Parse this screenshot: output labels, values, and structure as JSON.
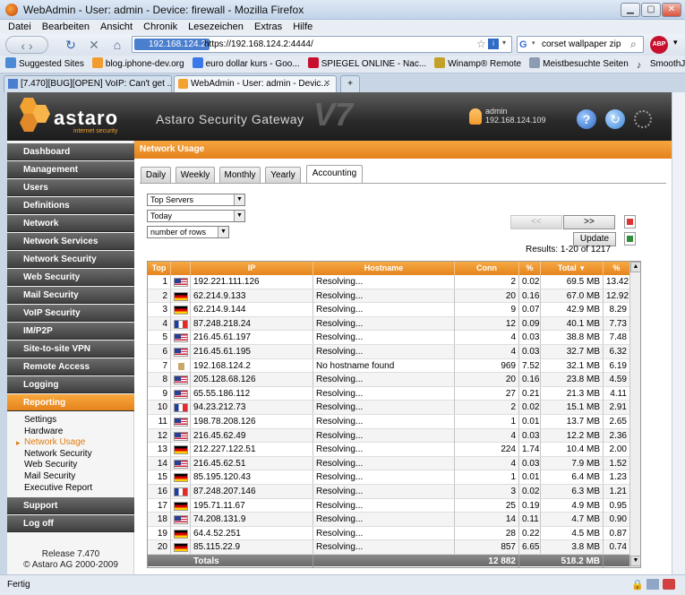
{
  "window": {
    "title": "WebAdmin - User: admin - Device: firewall - Mozilla Firefox"
  },
  "menu": [
    "Datei",
    "Bearbeiten",
    "Ansicht",
    "Chronik",
    "Lesezeichen",
    "Extras",
    "Hilfe"
  ],
  "address": {
    "site": "192.168.124.2",
    "url": "https://192.168.124.2:4444/"
  },
  "search": {
    "value": "corset wallpaper zip"
  },
  "bookmarks": [
    "Suggested Sites",
    "blog.iphone-dev.org",
    "euro dollar kurs - Goo...",
    "SPIEGEL ONLINE - Nac...",
    "Winamp® Remote",
    "Meistbesuchte Seiten",
    "SmoothJazz.com : The..."
  ],
  "browser_tabs": [
    {
      "label": "[7.470][BUG][OPEN] VoIP: Can't get ...",
      "active": false
    },
    {
      "label": "WebAdmin - User: admin - Devic...",
      "active": true
    }
  ],
  "header": {
    "brand": "astaro",
    "brand_sub": "internet security",
    "product": "Astaro Security Gateway",
    "version_mark": "V7",
    "user_label": "admin",
    "user_ip": "192.168.124.109"
  },
  "nav": {
    "items": [
      "Dashboard",
      "Management",
      "Users",
      "Definitions",
      "Network",
      "Network Services",
      "Network Security",
      "Web Security",
      "Mail Security",
      "VoIP Security",
      "IM/P2P",
      "Site-to-site VPN",
      "Remote Access",
      "Logging",
      "Reporting"
    ],
    "active": "Reporting",
    "sub_items": [
      "Settings",
      "Hardware",
      "Network Usage",
      "Network Security",
      "Web Security",
      "Mail Security",
      "Executive Report"
    ],
    "active_sub": "Network Usage",
    "bottom_items": [
      "Support",
      "Log off"
    ],
    "release": "Release 7.470",
    "copyright": "© Astaro AG 2000-2009"
  },
  "content": {
    "title": "Network Usage",
    "tabs": [
      "Daily",
      "Weekly",
      "Monthly",
      "Yearly",
      "Accounting"
    ],
    "active_tab": "Accounting",
    "filter_select": "Top Servers",
    "period_select": "Today",
    "rows_select": "number of rows",
    "prev_label": "<<",
    "next_label": ">>",
    "update_label": "Update",
    "results": "Results: 1-20 of 1217",
    "sort_arrow": "▼"
  },
  "table": {
    "headers": [
      "Top",
      "IP",
      "Hostname",
      "Conn",
      "%",
      "Total",
      "%"
    ],
    "rows": [
      {
        "top": "1",
        "flag": "us",
        "ip": "192.221.111.126",
        "host": "Resolving...",
        "conn": "2",
        "cpct": "0.02",
        "total": "69.5 MB",
        "tpct": "13.42"
      },
      {
        "top": "2",
        "flag": "de",
        "ip": "62.214.9.133",
        "host": "Resolving...",
        "conn": "20",
        "cpct": "0.16",
        "total": "67.0 MB",
        "tpct": "12.92"
      },
      {
        "top": "3",
        "flag": "de",
        "ip": "62.214.9.144",
        "host": "Resolving...",
        "conn": "9",
        "cpct": "0.07",
        "total": "42.9 MB",
        "tpct": "8.29"
      },
      {
        "top": "4",
        "flag": "fr",
        "ip": "87.248.218.24",
        "host": "Resolving...",
        "conn": "12",
        "cpct": "0.09",
        "total": "40.1 MB",
        "tpct": "7.73"
      },
      {
        "top": "5",
        "flag": "us",
        "ip": "216.45.61.197",
        "host": "Resolving...",
        "conn": "4",
        "cpct": "0.03",
        "total": "38.8 MB",
        "tpct": "7.48"
      },
      {
        "top": "6",
        "flag": "us",
        "ip": "216.45.61.195",
        "host": "Resolving...",
        "conn": "4",
        "cpct": "0.03",
        "total": "32.7 MB",
        "tpct": "6.32"
      },
      {
        "top": "7",
        "flag": "lan",
        "ip": "192.168.124.2",
        "host": "No hostname found",
        "conn": "969",
        "cpct": "7.52",
        "total": "32.1 MB",
        "tpct": "6.19"
      },
      {
        "top": "8",
        "flag": "us",
        "ip": "205.128.68.126",
        "host": "Resolving...",
        "conn": "20",
        "cpct": "0.16",
        "total": "23.8 MB",
        "tpct": "4.59"
      },
      {
        "top": "9",
        "flag": "us",
        "ip": "65.55.186.112",
        "host": "Resolving...",
        "conn": "27",
        "cpct": "0.21",
        "total": "21.3 MB",
        "tpct": "4.11"
      },
      {
        "top": "10",
        "flag": "fr",
        "ip": "94.23.212.73",
        "host": "Resolving...",
        "conn": "2",
        "cpct": "0.02",
        "total": "15.1 MB",
        "tpct": "2.91"
      },
      {
        "top": "11",
        "flag": "us",
        "ip": "198.78.208.126",
        "host": "Resolving...",
        "conn": "1",
        "cpct": "0.01",
        "total": "13.7 MB",
        "tpct": "2.65"
      },
      {
        "top": "12",
        "flag": "us",
        "ip": "216.45.62.49",
        "host": "Resolving...",
        "conn": "4",
        "cpct": "0.03",
        "total": "12.2 MB",
        "tpct": "2.36"
      },
      {
        "top": "13",
        "flag": "de",
        "ip": "212.227.122.51",
        "host": "Resolving...",
        "conn": "224",
        "cpct": "1.74",
        "total": "10.4 MB",
        "tpct": "2.00"
      },
      {
        "top": "14",
        "flag": "us",
        "ip": "216.45.62.51",
        "host": "Resolving...",
        "conn": "4",
        "cpct": "0.03",
        "total": "7.9 MB",
        "tpct": "1.52"
      },
      {
        "top": "15",
        "flag": "de",
        "ip": "85.195.120.43",
        "host": "Resolving...",
        "conn": "1",
        "cpct": "0.01",
        "total": "6.4 MB",
        "tpct": "1.23"
      },
      {
        "top": "16",
        "flag": "fr",
        "ip": "87.248.207.146",
        "host": "Resolving...",
        "conn": "3",
        "cpct": "0.02",
        "total": "6.3 MB",
        "tpct": "1.21"
      },
      {
        "top": "17",
        "flag": "de",
        "ip": "195.71.11.67",
        "host": "Resolving...",
        "conn": "25",
        "cpct": "0.19",
        "total": "4.9 MB",
        "tpct": "0.95"
      },
      {
        "top": "18",
        "flag": "us",
        "ip": "74.208.131.9",
        "host": "Resolving...",
        "conn": "14",
        "cpct": "0.11",
        "total": "4.7 MB",
        "tpct": "0.90"
      },
      {
        "top": "19",
        "flag": "de",
        "ip": "64.4.52.251",
        "host": "Resolving...",
        "conn": "28",
        "cpct": "0.22",
        "total": "4.5 MB",
        "tpct": "0.87"
      },
      {
        "top": "20",
        "flag": "de",
        "ip": "85.115.22.9",
        "host": "Resolving...",
        "conn": "857",
        "cpct": "6.65",
        "total": "3.8 MB",
        "tpct": "0.74"
      }
    ],
    "totals": {
      "label": "Totals",
      "conn": "12 882",
      "total": "518.2 MB"
    }
  },
  "status": {
    "text": "Fertig"
  }
}
